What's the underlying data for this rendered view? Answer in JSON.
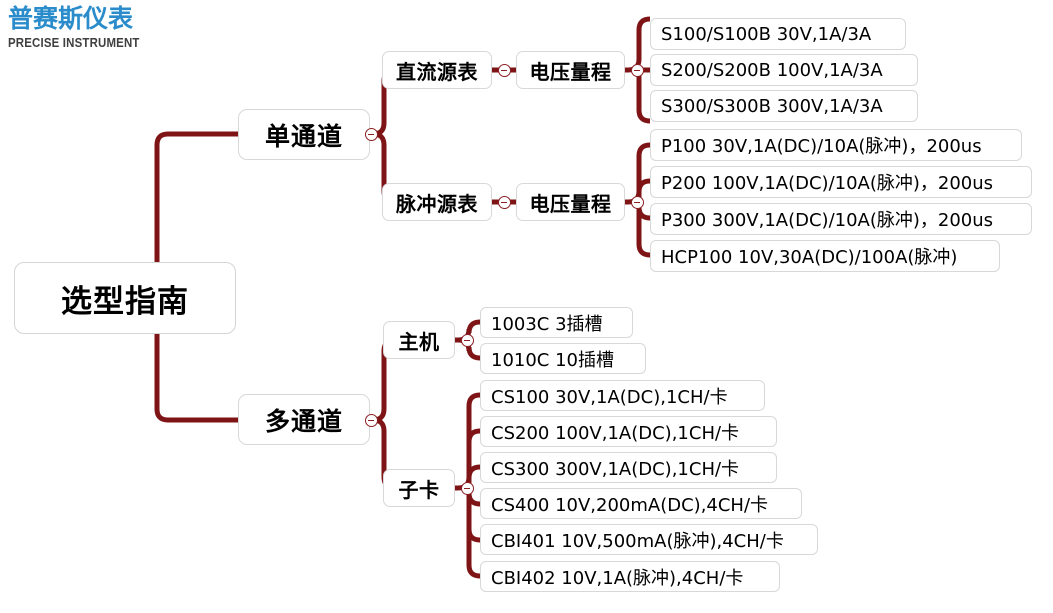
{
  "logo": {
    "cn": "普赛斯仪表",
    "en": "PRECISE INSTRUMENT",
    "brand_color": "#2a8ccb"
  },
  "theme": {
    "link_color": "#7e1416",
    "node_border": "#d8d8d8",
    "node_background": "#ffffff",
    "text_color": "#000000"
  },
  "chart_data": {
    "type": "diagram",
    "subtype": "mind-map",
    "title": "选型指南",
    "orientation": "left-to-right",
    "root": {
      "label": "选型指南",
      "children": [
        {
          "label": "单通道",
          "children": [
            {
              "label": "直流源表",
              "children": [
                {
                  "label": "电压量程",
                  "children": [
                    {
                      "label": "S100/S100B   30V,1A/3A"
                    },
                    {
                      "label": "S200/S200B   100V,1A/3A"
                    },
                    {
                      "label": "S300/S300B   300V,1A/3A"
                    }
                  ]
                }
              ]
            },
            {
              "label": "脉冲源表",
              "children": [
                {
                  "label": "电压量程",
                  "children": [
                    {
                      "label": "P100   30V,1A(DC)/10A(脉冲)，200us"
                    },
                    {
                      "label": "P200   100V,1A(DC)/10A(脉冲)，200us"
                    },
                    {
                      "label": "P300   300V,1A(DC)/10A(脉冲)，200us"
                    },
                    {
                      "label": "HCP100     10V,30A(DC)/100A(脉冲)"
                    }
                  ]
                }
              ]
            }
          ]
        },
        {
          "label": "多通道",
          "children": [
            {
              "label": "主机",
              "children": [
                {
                  "label": "1003C     3插槽"
                },
                {
                  "label": "1010C     10插槽"
                }
              ]
            },
            {
              "label": "子卡",
              "children": [
                {
                  "label": "CS100     30V,1A(DC),1CH/卡"
                },
                {
                  "label": "CS200     100V,1A(DC),1CH/卡"
                },
                {
                  "label": "CS300     300V,1A(DC),1CH/卡"
                },
                {
                  "label": "CS400     10V,200mA(DC),4CH/卡"
                },
                {
                  "label": "CBI401    10V,500mA(脉冲),4CH/卡"
                },
                {
                  "label": "CBI402    10V,1A(脉冲),4CH/卡"
                }
              ]
            }
          ]
        }
      ]
    }
  },
  "nodes": {
    "root": "选型指南",
    "single_channel": "单通道",
    "multi_channel": "多通道",
    "dc_source": "直流源表",
    "pulse_source": "脉冲源表",
    "voltage_range_dc": "电压量程",
    "voltage_range_pulse": "电压量程",
    "host": "主机",
    "subcard": "子卡",
    "s100": "S100/S100B   30V,1A/3A",
    "s200": "S200/S200B   100V,1A/3A",
    "s300": "S300/S300B   300V,1A/3A",
    "p100": "P100   30V,1A(DC)/10A(脉冲)，200us",
    "p200": "P200   100V,1A(DC)/10A(脉冲)，200us",
    "p300": "P300   300V,1A(DC)/10A(脉冲)，200us",
    "hcp100": "HCP100     10V,30A(DC)/100A(脉冲)",
    "host_1003c": "1003C     3插槽",
    "host_1010c": "1010C     10插槽",
    "cs100": "CS100     30V,1A(DC),1CH/卡",
    "cs200": "CS200     100V,1A(DC),1CH/卡",
    "cs300": "CS300     300V,1A(DC),1CH/卡",
    "cs400": "CS400     10V,200mA(DC),4CH/卡",
    "cbi401": "CBI401    10V,500mA(脉冲),4CH/卡",
    "cbi402": "CBI402    10V,1A(脉冲),4CH/卡"
  }
}
